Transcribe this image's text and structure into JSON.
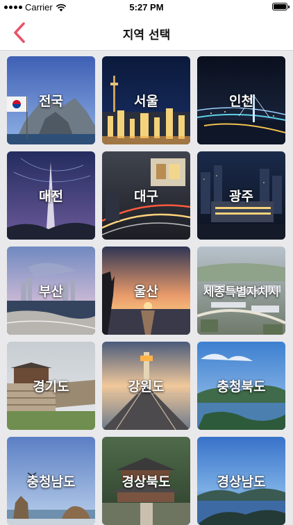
{
  "status_bar": {
    "carrier": "Carrier",
    "time": "5:27 PM"
  },
  "nav": {
    "title": "지역 선택",
    "back_icon": "chevron-left-icon",
    "accent": "#e8546b"
  },
  "regions": [
    {
      "label": "전국"
    },
    {
      "label": "서울"
    },
    {
      "label": "인천"
    },
    {
      "label": "대전"
    },
    {
      "label": "대구"
    },
    {
      "label": "광주"
    },
    {
      "label": "부산"
    },
    {
      "label": "울산"
    },
    {
      "label": "세종특별자치시"
    },
    {
      "label": "경기도"
    },
    {
      "label": "강원도"
    },
    {
      "label": "충청북도"
    },
    {
      "label": "충청남도"
    },
    {
      "label": "경상북도"
    },
    {
      "label": "경상남도"
    }
  ]
}
